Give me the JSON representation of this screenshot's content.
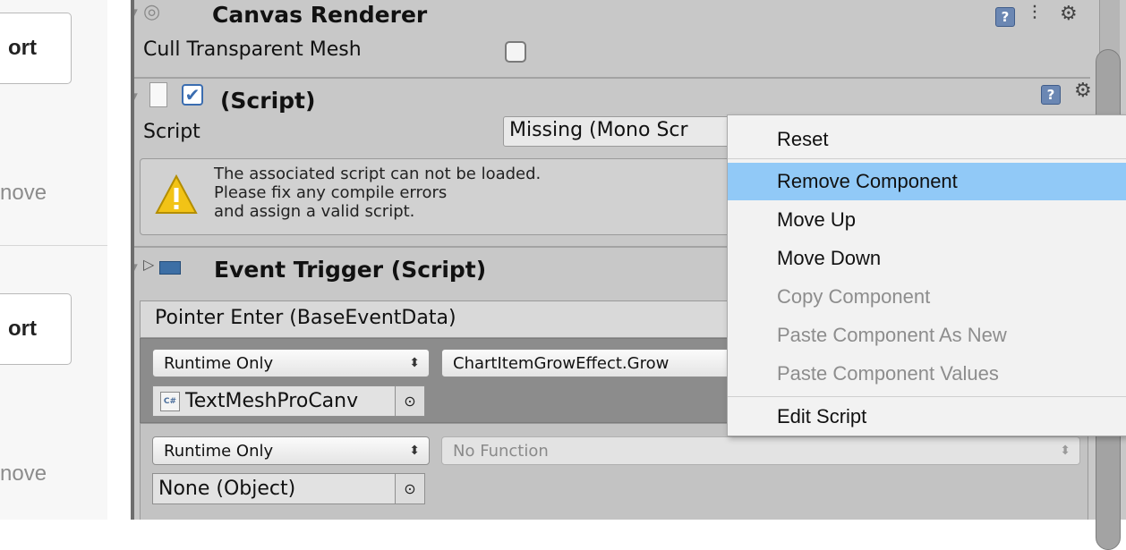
{
  "left_panel": {
    "buttons": [
      "ort",
      "ort"
    ],
    "labels": [
      "nove",
      "nove"
    ]
  },
  "canvas_renderer": {
    "title": "Canvas Renderer",
    "property": "Cull Transparent Mesh"
  },
  "script_component": {
    "title": "(Script)",
    "script_label": "Script",
    "script_value": "Missing (Mono Scr",
    "warning_lines": [
      "The associated script can not be loaded.",
      "Please fix any compile errors",
      "and assign a valid script."
    ]
  },
  "event_trigger": {
    "title": "Event Trigger (Script)",
    "event_header": "Pointer Enter (BaseEventData)",
    "entries": [
      {
        "runtime": "Runtime Only",
        "function": "ChartItemGrowEffect.Grow",
        "object": "TextMeshProCanv",
        "object_badge": "C#"
      },
      {
        "runtime": "Runtime Only",
        "function": "No Function",
        "object": "None (Object)"
      }
    ]
  },
  "context_menu": {
    "items": [
      {
        "label": "Reset",
        "enabled": true,
        "highlighted": false
      },
      {
        "label": "Remove Component",
        "enabled": true,
        "highlighted": true
      },
      {
        "label": "Move Up",
        "enabled": true,
        "highlighted": false
      },
      {
        "label": "Move Down",
        "enabled": true,
        "highlighted": false
      },
      {
        "label": "Copy Component",
        "enabled": false,
        "highlighted": false
      },
      {
        "label": "Paste Component As New",
        "enabled": false,
        "highlighted": false
      },
      {
        "label": "Paste Component Values",
        "enabled": false,
        "highlighted": false
      },
      {
        "label": "Edit Script",
        "enabled": true,
        "highlighted": false
      }
    ]
  },
  "colors": {
    "inspector_bg": "#c8c8c8",
    "menu_highlight": "#91c9f7",
    "warning_yellow": "#f2c316"
  }
}
